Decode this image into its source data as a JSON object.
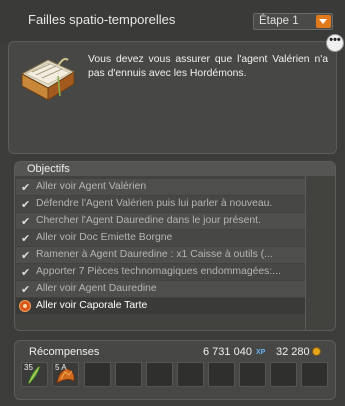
{
  "header": {
    "title": "Failles spatio-temporelles",
    "step_selected": "Étape 1"
  },
  "description": {
    "more_label": "•••",
    "text": "Vous devez vous assurer que l'agent Valérien n'a pas d'ennuis avec les Hordémons."
  },
  "objectives": {
    "header": "Objectifs",
    "items": [
      {
        "label": "Aller voir Agent Valérien",
        "done": true
      },
      {
        "label": "Défendre l'Agent Valérien puis lui parler à nouveau.",
        "done": true
      },
      {
        "label": "Chercher l'Agent Dauredine dans le jour présent.",
        "done": true
      },
      {
        "label": "Aller voir Doc Emiette Borgne",
        "done": true
      },
      {
        "label": "Ramener à Agent Dauredine : x1 Caisse à outils (...",
        "done": true
      },
      {
        "label": "Apporter 7 Pièces technomagiques endommagées:...",
        "done": true
      },
      {
        "label": "Aller voir Agent Dauredine",
        "done": true
      },
      {
        "label": "Aller voir Caporale Tarte",
        "done": false
      }
    ]
  },
  "rewards": {
    "label": "Récompenses",
    "xp": "6 731 040",
    "xp_unit": "XP",
    "kamas": "32 280",
    "items": [
      {
        "count": "35",
        "icon": "feather-icon"
      },
      {
        "count": "5 A",
        "icon": "leaf-icon"
      }
    ]
  },
  "colors": {
    "accent": "#e07a1a",
    "background": "#3c3c3a",
    "panel": "#474745"
  }
}
